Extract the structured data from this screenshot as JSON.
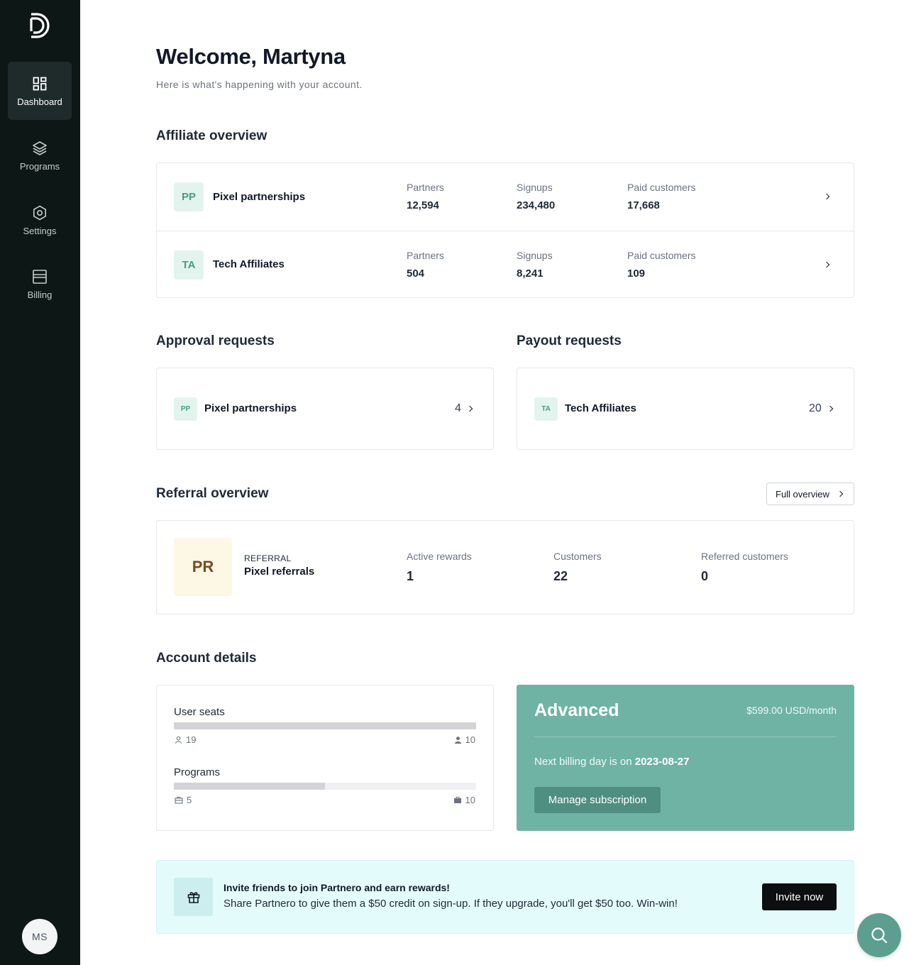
{
  "sidebar": {
    "items": [
      {
        "label": "Dashboard",
        "icon": "dashboard-icon"
      },
      {
        "label": "Programs",
        "icon": "layers-icon"
      },
      {
        "label": "Settings",
        "icon": "gear-icon"
      },
      {
        "label": "Billing",
        "icon": "billing-icon"
      }
    ],
    "avatar": "MS"
  },
  "header": {
    "title": "Welcome, Martyna",
    "subtitle": "Here is what's happening with your account."
  },
  "affiliate": {
    "heading": "Affiliate overview",
    "rows": [
      {
        "badge": "PP",
        "name": "Pixel partnerships",
        "partners_label": "Partners",
        "partners": "12,594",
        "signups_label": "Signups",
        "signups": "234,480",
        "paid_label": "Paid customers",
        "paid": "17,668"
      },
      {
        "badge": "TA",
        "name": "Tech Affiliates",
        "partners_label": "Partners",
        "partners": "504",
        "signups_label": "Signups",
        "signups": "8,241",
        "paid_label": "Paid customers",
        "paid": "109"
      }
    ]
  },
  "approval": {
    "heading": "Approval requests",
    "badge": "PP",
    "name": "Pixel partnerships",
    "count": "4"
  },
  "payout": {
    "heading": "Payout requests",
    "badge": "TA",
    "name": "Tech Affiliates",
    "count": "20"
  },
  "referral": {
    "heading": "Referral overview",
    "full_overview": "Full overview",
    "badge": "PR",
    "type": "REFERRAL",
    "name": "Pixel referrals",
    "active_label": "Active rewards",
    "active": "1",
    "customers_label": "Customers",
    "customers": "22",
    "referred_label": "Referred customers",
    "referred": "0"
  },
  "account": {
    "heading": "Account details",
    "seats_label": "User seats",
    "seats_used": "19",
    "seats_total": "10",
    "seats_fill": 1.0,
    "programs_label": "Programs",
    "programs_used": "5",
    "programs_total": "10",
    "programs_fill": 0.5
  },
  "plan": {
    "name": "Advanced",
    "price": "$599.00 USD/month",
    "next_prefix": "Next billing day is on",
    "next_date": "2023-08-27",
    "manage": "Manage subscription"
  },
  "invite": {
    "title": "Invite friends to join Partnero and earn rewards!",
    "text": "Share Partnero to give them a $50 credit on sign-up. If they upgrade, you'll get $50 too. Win-win!",
    "button": "Invite now"
  },
  "colors": {
    "sidebar": "#0c1716",
    "accent": "#6fb3a4",
    "badge_bg": "#e3f4ee"
  }
}
